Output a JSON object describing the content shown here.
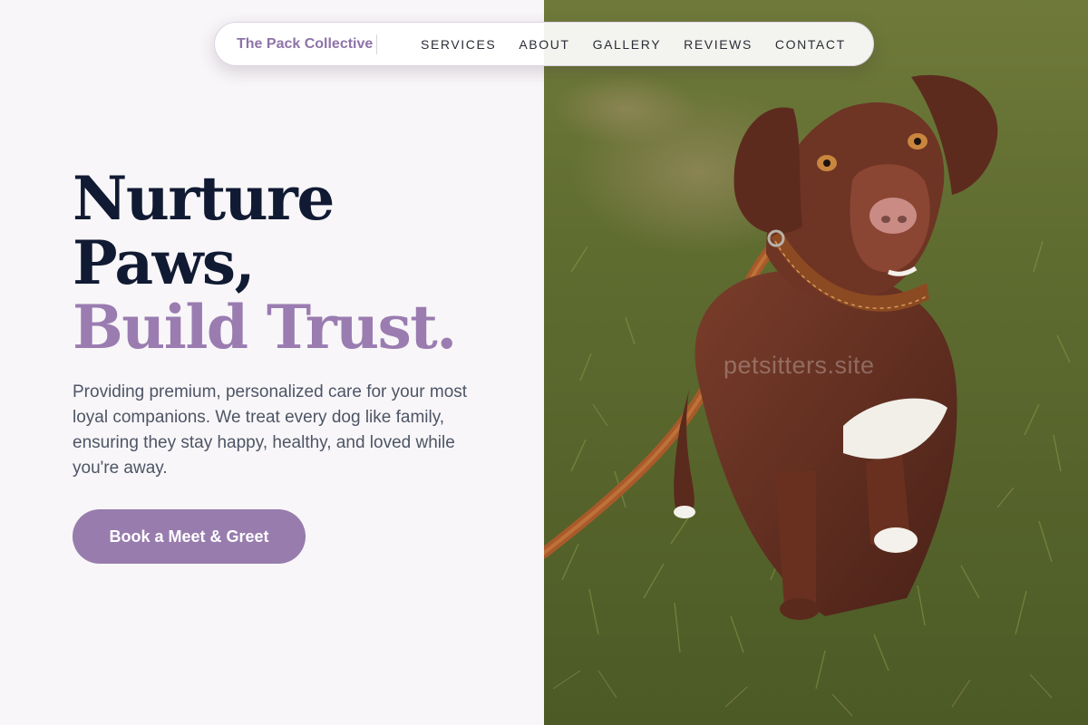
{
  "nav": {
    "brand": "The Pack Collective",
    "links": [
      "SERVICES",
      "ABOUT",
      "GALLERY",
      "REVIEWS",
      "CONTACT"
    ]
  },
  "hero": {
    "headline_line1": "Nurture",
    "headline_line2": "Paws,",
    "headline_line3": "Build Trust.",
    "subtitle": "Providing premium, personalized care for your most loyal companions. We treat every dog like family, ensuring they stay happy, healthy, and loved while you're away.",
    "cta_label": "Book a Meet & Greet"
  },
  "image": {
    "watermark": "petsitters.site"
  },
  "colors": {
    "accent": "#977cad",
    "heading": "#111a33",
    "body_text": "#4d5566",
    "background": "#f8f6f8"
  }
}
